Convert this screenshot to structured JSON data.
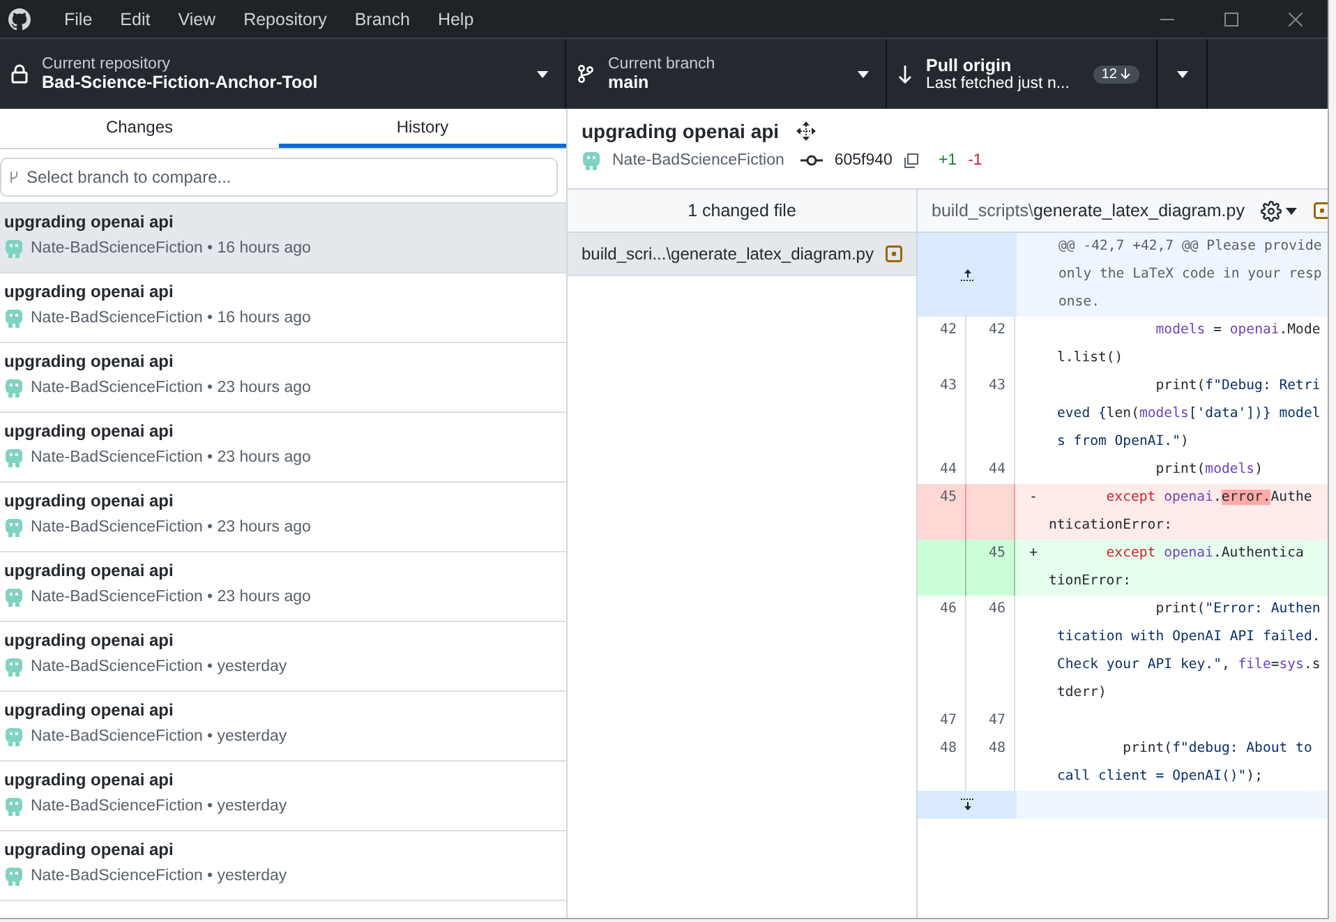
{
  "menu": [
    "File",
    "Edit",
    "View",
    "Repository",
    "Branch",
    "Help"
  ],
  "toolbar": {
    "repository": {
      "label": "Current repository",
      "value": "Bad-Science-Fiction-Anchor-Tool"
    },
    "branch": {
      "label": "Current branch",
      "value": "main"
    },
    "pull": {
      "label": "Pull origin",
      "detail": "Last fetched just n...",
      "count": "12"
    }
  },
  "tabs": [
    {
      "label": "Changes",
      "selected": false
    },
    {
      "label": "History",
      "selected": true
    }
  ],
  "branch_filter": {
    "placeholder": "Select branch to compare..."
  },
  "commits": [
    {
      "title": "upgrading openai api",
      "meta": "Nate-BadScienceFiction • 16 hours ago",
      "selected": true
    },
    {
      "title": "upgrading openai api",
      "meta": "Nate-BadScienceFiction • 16 hours ago",
      "selected": false
    },
    {
      "title": "upgrading openai api",
      "meta": "Nate-BadScienceFiction • 23 hours ago",
      "selected": false
    },
    {
      "title": "upgrading openai api",
      "meta": "Nate-BadScienceFiction • 23 hours ago",
      "selected": false
    },
    {
      "title": "upgrading openai api",
      "meta": "Nate-BadScienceFiction • 23 hours ago",
      "selected": false
    },
    {
      "title": "upgrading openai api",
      "meta": "Nate-BadScienceFiction • 23 hours ago",
      "selected": false
    },
    {
      "title": "upgrading openai api",
      "meta": "Nate-BadScienceFiction • yesterday",
      "selected": false
    },
    {
      "title": "upgrading openai api",
      "meta": "Nate-BadScienceFiction • yesterday",
      "selected": false
    },
    {
      "title": "upgrading openai api",
      "meta": "Nate-BadScienceFiction • yesterday",
      "selected": false
    },
    {
      "title": "upgrading openai api",
      "meta": "Nate-BadScienceFiction • yesterday",
      "selected": false
    }
  ],
  "commit": {
    "title": "upgrading openai api",
    "author": "Nate-BadScienceFiction",
    "sha": "605f940",
    "added": "+1",
    "removed": "-1"
  },
  "files": {
    "header": "1 changed file",
    "items": [
      {
        "path": "build_scri...\\generate_latex_diagram.py",
        "selected": true
      }
    ]
  },
  "diff": {
    "dir": "build_scripts\\",
    "name": "generate_latex_diagram.py",
    "rows": [
      {
        "kind": "hunk",
        "lines": [
          [
            {
              "t": "@@ -42,7 +42,7 @@ Please provide",
              "kind": "meta"
            }
          ],
          [
            {
              "t": "only the LaTeX code in your resp",
              "kind": "meta"
            }
          ],
          [
            {
              "t": "onse.",
              "kind": "meta"
            }
          ]
        ]
      },
      {
        "kind": "context",
        "old": "42",
        "new": "42",
        "lines": [
          [
            {
              "t": "            models",
              "kind": "name"
            },
            {
              "t": " = ",
              "kind": "plain"
            },
            {
              "t": "openai",
              "kind": "name"
            },
            {
              "t": ".Mode",
              "kind": "plain"
            }
          ],
          [
            {
              "t": "l.list()",
              "kind": "plain"
            }
          ]
        ]
      },
      {
        "kind": "context",
        "old": "43",
        "new": "43",
        "lines": [
          [
            {
              "t": "            print(",
              "kind": "plain"
            },
            {
              "t": "f\"Debug: Retri",
              "kind": "string"
            }
          ],
          [
            {
              "t": "eved {",
              "kind": "string"
            },
            {
              "t": "len(",
              "kind": "plain"
            },
            {
              "t": "models",
              "kind": "name"
            },
            {
              "t": "['data'])} model",
              "kind": "string"
            }
          ],
          [
            {
              "t": "s from OpenAI.\"",
              "kind": "string"
            },
            {
              "t": ")",
              "kind": "plain"
            }
          ]
        ]
      },
      {
        "kind": "context",
        "old": "44",
        "new": "44",
        "lines": [
          [
            {
              "t": "            print(",
              "kind": "plain"
            },
            {
              "t": "models",
              "kind": "name"
            },
            {
              "t": ")",
              "kind": "plain"
            }
          ]
        ]
      },
      {
        "kind": "deleted",
        "old": "45",
        "marker": "-",
        "lines": [
          [
            {
              "t": "       except",
              "kind": "keyword"
            },
            {
              "t": " openai",
              "kind": "name"
            },
            {
              "t": ".",
              "kind": "plain"
            },
            {
              "t": "error.",
              "kind": "changed"
            },
            {
              "t": "Authe",
              "kind": "plain"
            }
          ],
          [
            {
              "t": "nticationError:",
              "kind": "plain"
            }
          ]
        ]
      },
      {
        "kind": "added",
        "new": "45",
        "marker": "+",
        "lines": [
          [
            {
              "t": "       except",
              "kind": "keyword"
            },
            {
              "t": " openai",
              "kind": "name"
            },
            {
              "t": ".Authentica",
              "kind": "plain"
            }
          ],
          [
            {
              "t": "tionError:",
              "kind": "plain"
            }
          ]
        ]
      },
      {
        "kind": "context",
        "old": "46",
        "new": "46",
        "lines": [
          [
            {
              "t": "            print(",
              "kind": "plain"
            },
            {
              "t": "\"Error: Authen",
              "kind": "string"
            }
          ],
          [
            {
              "t": "tication with OpenAI API failed.",
              "kind": "string"
            }
          ],
          [
            {
              "t": "Check your API key.\"",
              "kind": "string"
            },
            {
              "t": ", ",
              "kind": "plain"
            },
            {
              "t": "file",
              "kind": "name"
            },
            {
              "t": "=",
              "kind": "plain"
            },
            {
              "t": "sys",
              "kind": "name"
            },
            {
              "t": ".s",
              "kind": "plain"
            }
          ],
          [
            {
              "t": "tderr)",
              "kind": "plain"
            }
          ]
        ]
      },
      {
        "kind": "context",
        "old": "47",
        "new": "47"
      },
      {
        "kind": "context",
        "old": "48",
        "new": "48",
        "lines": [
          [
            {
              "t": "        print(",
              "kind": "plain"
            },
            {
              "t": "f\"debug: About to",
              "kind": "string"
            }
          ],
          [
            {
              "t": "call client = OpenAI()\"",
              "kind": "string"
            },
            {
              "t": ");",
              "kind": "plain"
            }
          ]
        ]
      },
      {
        "kind": "expand"
      }
    ]
  }
}
